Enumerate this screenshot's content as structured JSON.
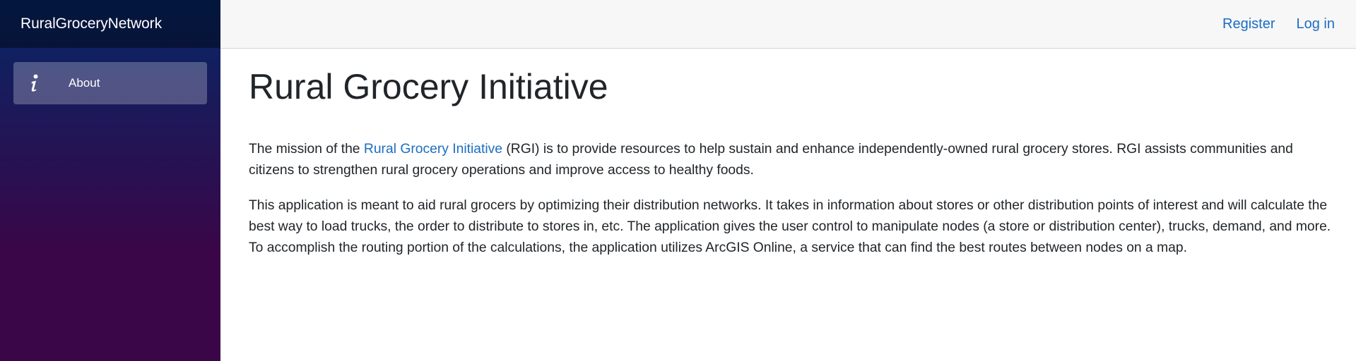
{
  "sidebar": {
    "brand": "RuralGroceryNetwork",
    "items": [
      {
        "label": "About",
        "icon": "info-icon"
      }
    ]
  },
  "header": {
    "register_label": "Register",
    "login_label": "Log in"
  },
  "main": {
    "title": "Rural Grocery Initiative",
    "intro": {
      "before_link": "The mission of the ",
      "link_text": "Rural Grocery Initiative",
      "after_link": " (RGI) is to provide resources to help sustain and enhance independently-owned rural grocery stores. RGI assists communities and citizens to strengthen rural grocery operations and improve access to healthy foods."
    },
    "description": "This application is meant to aid rural grocers by optimizing their distribution networks. It takes in information about stores or other distribution points of interest and will calculate the best way to load trucks, the order to distribute to stores in, etc. The application gives the user control to manipulate nodes (a store or distribution center), trucks, demand, and more. To accomplish the routing portion of the calculations, the application utilizes ArcGIS Online, a service that can find the best routes between nodes on a map."
  },
  "colors": {
    "link": "#1b6ec2",
    "sidebar_gradient_top": "#052767",
    "sidebar_gradient_bottom": "#3a0647",
    "top_row_bg": "#f7f7f7"
  }
}
